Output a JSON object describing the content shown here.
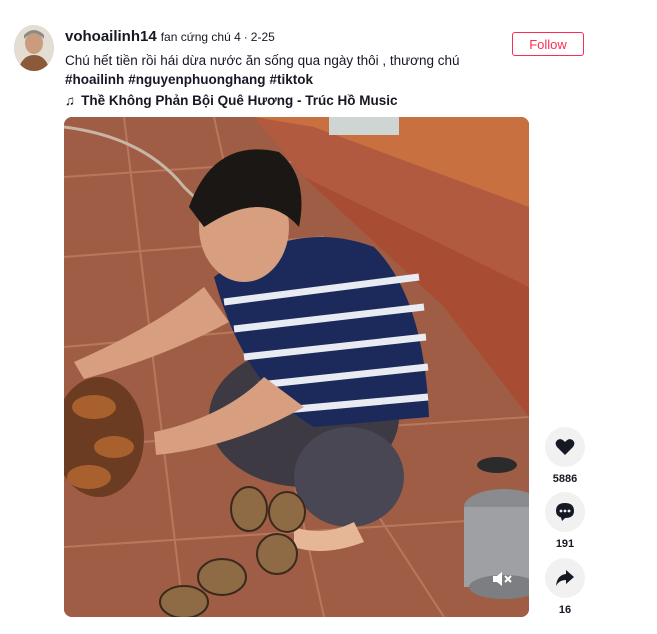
{
  "post": {
    "username": "vohoailinh14",
    "nickname": "fan cứng chú 4",
    "separator": "·",
    "date": "2-25",
    "caption": "Chú hết tiền rồi hái dừa nước ăn sống qua ngày thôi , thương chú",
    "hashtags": [
      "#hoailinh",
      "#nguyenphuonghang",
      "#tiktok"
    ],
    "music_icon": "♫",
    "music": "Thề Không Phản Bội Quê Hương - Trúc Hồ Music",
    "follow_label": "Follow"
  },
  "actions": {
    "likes": "5886",
    "comments": "191",
    "shares": "16"
  },
  "icons": {
    "avatar": "avatar-icon",
    "like": "heart-icon",
    "comment": "comment-icon",
    "share": "share-icon",
    "mute": "muted-speaker-icon"
  },
  "colors": {
    "accent": "#fe2c55",
    "action_bg": "#f1f1f2",
    "text": "#161823"
  }
}
